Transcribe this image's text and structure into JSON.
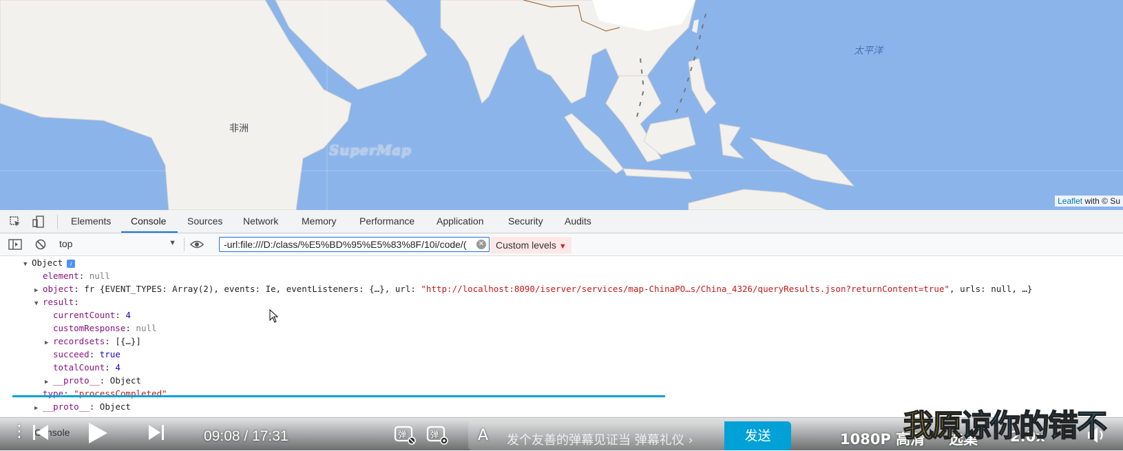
{
  "map": {
    "labels": {
      "africa": "非洲",
      "pacific": "太平洋"
    },
    "watermark": "SuperMap",
    "attribution": {
      "link": "Leaflet",
      "rest": " with © Su"
    },
    "colors": {
      "ocean": "#8bb4ea",
      "land": "#f3f1ed",
      "border": "#a07040"
    }
  },
  "devtools": {
    "tabs": [
      "Elements",
      "Console",
      "Sources",
      "Network",
      "Memory",
      "Performance",
      "Application",
      "Security",
      "Audits"
    ],
    "active_tab": "Console",
    "toolbar": {
      "context": "top",
      "filter_value": "-url:file:///D:/class/%E5%BD%95%E5%83%8F/10i/code/(",
      "levels": "Custom levels"
    },
    "console": {
      "root": "Object",
      "element_key": "element",
      "element_val": "null",
      "object_key": "object",
      "object_prefix": " fr {EVENT_TYPES: Array(2), events: Ie, eventListeners: {…}, url: ",
      "object_url": "\"http://localhost:8090/iserver/services/map-ChinaPO…s/China_4326/queryResults.json?returnContent=true\"",
      "object_suffix": ", urls: null, …}",
      "result_key": "result",
      "currentCount_key": "currentCount",
      "currentCount_val": "4",
      "customResponse_key": "customResponse",
      "customResponse_val": "null",
      "recordsets_key": "recordsets",
      "recordsets_val": " [{…}]",
      "succeed_key": "succeed",
      "succeed_val": "true",
      "totalCount_key": "totalCount",
      "totalCount_val": "4",
      "proto_key": "__proto__",
      "proto_val": " Object",
      "type_key": "type",
      "type_val": "\"processCompleted\"",
      "proto2_key": "__proto__",
      "proto2_val": " Object"
    },
    "drawer_label": "Console"
  },
  "player": {
    "time_current": "09:08",
    "time_sep": " / ",
    "time_total": "17:31",
    "progress": 0.85,
    "danmaku_placeholder": "发个友善的弹幕见证当",
    "danmaku_etiquette": "弹幕礼仪 ›",
    "send_label": "发送",
    "quality": "1080P 高清",
    "select": "选集",
    "speed": "2.0x",
    "subtitle_part1": "我原",
    "subtitle_part2": "谅你的错不"
  }
}
